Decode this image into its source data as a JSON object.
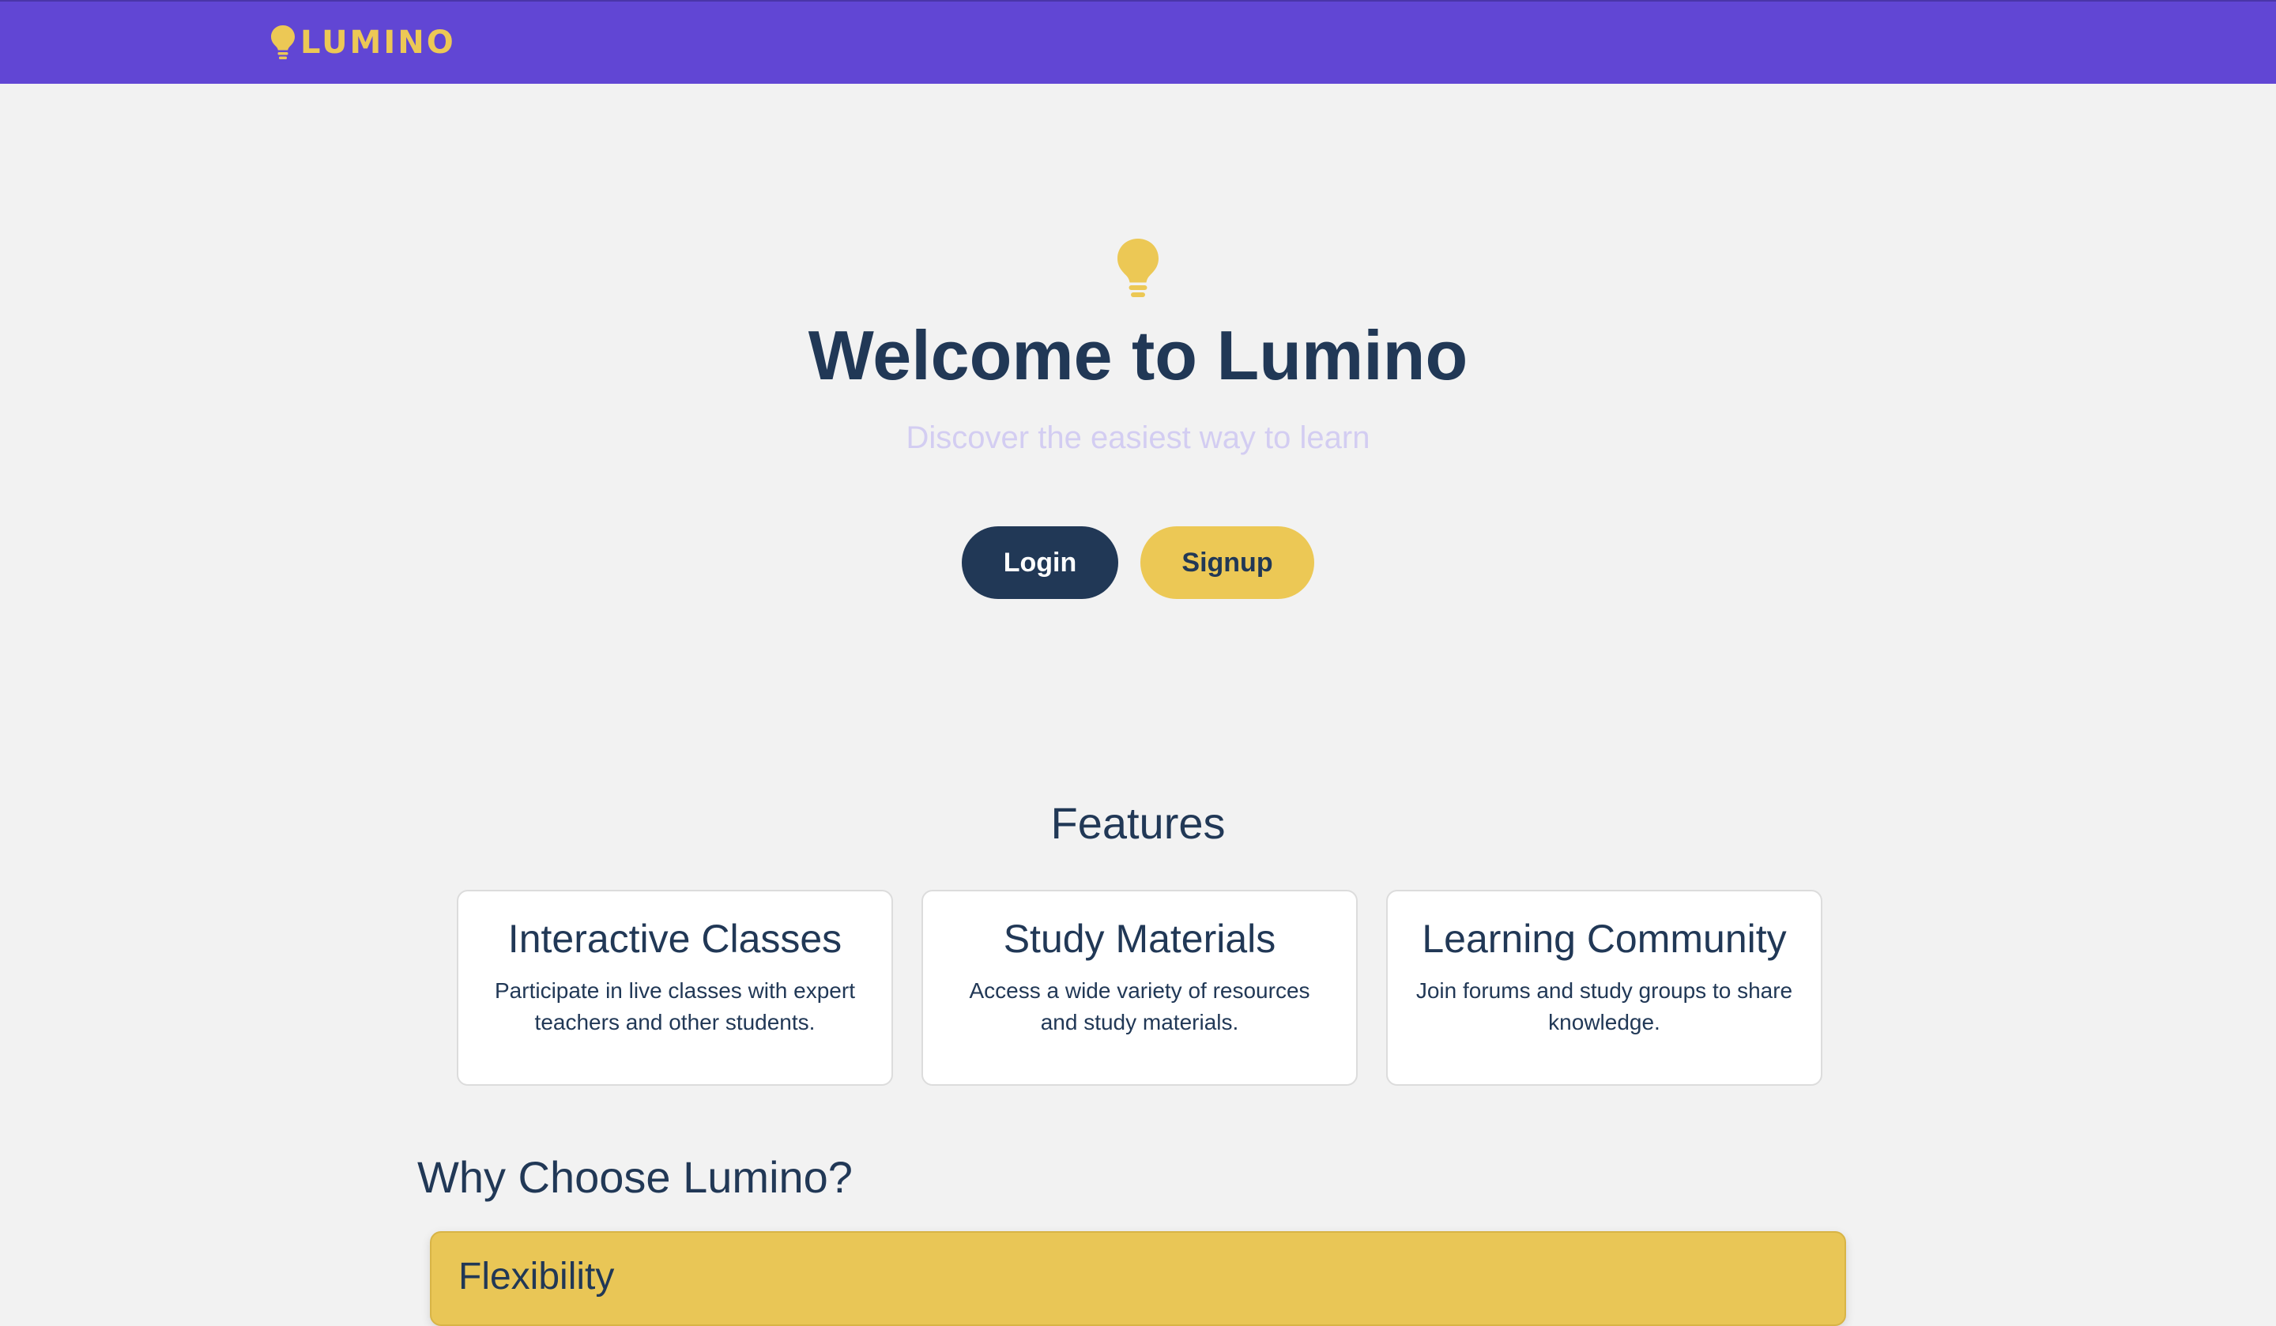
{
  "header": {
    "brand_name": "LUMINO",
    "brand_icon": "lightbulb-icon",
    "background_color": "#6146d4",
    "brand_color": "#ecc855"
  },
  "hero": {
    "icon": "lightbulb-icon",
    "title": "Welcome to Lumino",
    "subtitle": "Discover the easiest way to learn",
    "login_label": "Login",
    "signup_label": "Signup"
  },
  "features": {
    "title": "Features",
    "items": [
      {
        "title": "Interactive Classes",
        "description": "Participate in live classes with expert teachers and other students."
      },
      {
        "title": "Study Materials",
        "description": "Access a wide variety of resources and study materials."
      },
      {
        "title": "Learning Community",
        "description": "Join forums and study groups to share knowledge."
      }
    ]
  },
  "why": {
    "title": "Why Choose Lumino?",
    "items": [
      {
        "title": "Flexibility"
      }
    ]
  },
  "colors": {
    "primary_dark": "#213856",
    "accent_yellow": "#ecc855",
    "brand_purple": "#6146d4",
    "page_background": "#f2f2f2"
  }
}
